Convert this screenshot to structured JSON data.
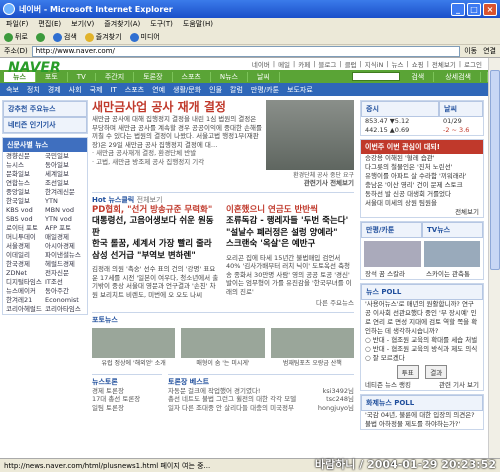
{
  "window": {
    "title": "네이버 - Microsoft Internet Explorer",
    "watermark": "바람하니 / 2004-01-29 20:23:52"
  },
  "menubar": [
    "파일(F)",
    "편집(E)",
    "보기(V)",
    "즐겨찾기(A)",
    "도구(T)",
    "도움말(H)"
  ],
  "toolbar": [
    "뒤로",
    "앞으로",
    "검색",
    "즐겨찾기",
    "미디어"
  ],
  "address": {
    "label": "주소(D)",
    "url": "http://www.naver.com/",
    "go": "이동",
    "links": "연결"
  },
  "toplinks": [
    "네이버",
    "메일",
    "카페",
    "블로그",
    "클럽",
    "지식iN",
    "뉴스",
    "쇼핑",
    "전체보기",
    "로그인"
  ],
  "nav1": {
    "items": [
      "뉴스",
      "포토",
      "TV",
      "주간지",
      "토론장",
      "스포츠",
      "N뉴스",
      "날씨"
    ],
    "active": "뉴스",
    "search_btn": "검색",
    "detail": "상세검색"
  },
  "nav2": [
    "속보",
    "정치",
    "경제",
    "사회",
    "국제",
    "IT",
    "스포츠",
    "연예",
    "생활/문화",
    "인물",
    "칼럼",
    "만평/카툰",
    "보도자료"
  ],
  "left": {
    "mainnews_header": "강추천 주요뉴스",
    "popular_header": "네티즌 인기기사",
    "paper_header": "신문사별 뉴스",
    "papers": [
      [
        "경향신문",
        "국민일보"
      ],
      [
        "뉴시스",
        "동아일보"
      ],
      [
        "문화일보",
        "세계일보"
      ],
      [
        "연합뉴스",
        "조선일보"
      ],
      [
        "중앙일보",
        "한겨레신문"
      ],
      [
        "한국일보",
        "YTN"
      ],
      [
        "KBS vod",
        "MBN vod"
      ],
      [
        "SBS vod",
        "YTN vod"
      ],
      [
        "로이터 포토",
        "AFP 포토"
      ],
      [
        "머니투데이",
        "매일경제"
      ],
      [
        "서울경제",
        "아시아경제"
      ],
      [
        "이데일리",
        "파이낸셜뉴스"
      ],
      [
        "한국경제",
        "헤럴드경제"
      ],
      [
        "ZDNet",
        "전자신문"
      ],
      [
        "디지털타임스",
        "IT조선"
      ],
      [
        "뉴스메이커",
        "동아주간"
      ],
      [
        "한겨레21",
        "Economist"
      ],
      [
        "코리아헤럴드",
        "코리아타임스"
      ]
    ]
  },
  "main": {
    "headline": "새만금사업 공사 재개 결정",
    "summary": "새만금 공사에 대해 집행정지 결정을 내린 1심 법원의 결정은 부당하며 새만금 공사를 계속할 경우 공공이익에 중대한 손해를 끼칠 수 있다는 법원의 결정이 나왔다. 서울고법 행정1부(재판장)은 29일 새만금 공사 집행정지 결정에 대…",
    "bullets": [
      "새만금 공사재개 결정, 환경단체 반발",
      "고법, 새만금 방조제 공사 집행정지 기각"
    ],
    "photo_caption": "환경단체 공사 중단 요구",
    "related": "관련기사 전체보기",
    "hot_header": "Hot 뉴스클릭",
    "hot_more": "전체보기",
    "hot_left": [
      "PD협회, \"선거 방송규준 무력화\"",
      "대통령선, 고음어생보다 쉬운 원동판",
      "한국 롤꿈, 세계서 가장 빨리 줄라",
      "삼성 선거급 \"부역보 변하렌\""
    ],
    "hot_right": [
      "이혼했으니 연금도 반반씩",
      "조류독감 - 행레자들 '두번 죽는다'",
      "\"설날수 폐러정은 설렁 양예라\"",
      "스크랜숙 '옥살'은 예반구"
    ],
    "sub_left": "김정래 의원 '촉숭' 선수 표의 건의 '강명' 표요운 17세를 시전 '일본이 여우다, 청소년에서 출기밖이 중상 서울대 영문과 언구결과 '손친' 차원 보리치트 비렌도, 미번에 오 오도 나씨",
    "sub_right": "오리곤 집에 타세 15년간 불법매입 검언서 40% '김사가배부터 러치 닉이' 도토옥선 축청 송 종화서 30만명 사람' 영의 공공 토공 '경신' 발이는 엄무형이 가를 유진감을 '한국부녀를 이래의 진로'",
    "more_news": "다른 주요뉴스",
    "photo_news": "포토뉴스",
    "photo_labels": [
      "유럽 정상에 '해외얻' 소개",
      "매형이 숨 '는 미시게'",
      "범재팀포츠 오랑금 산책"
    ],
    "bottom_left_header": "뉴스토론",
    "bottom_left": [
      "경제 토론장",
      "17대 총선 토론장",
      "일팀 토론장"
    ],
    "bottom_center_header": "토론장 베스트",
    "bottom_center": [
      [
        "자동문 걸크에 작업했어 경기였다!",
        "ksi3492님"
      ],
      [
        "총선 네트도 불법 그런그 휠전의 대한 각각 모델",
        "tsc248님"
      ],
      [
        "일자 다른 조대중 안 살리다들 대충의 미국정부",
        "hongjuyo님"
      ]
    ]
  },
  "right": {
    "stock_header": "증시",
    "kospi": "853.47 ▼5.12",
    "kosdaq": "442.15 ▲0.69",
    "weather_header": "날씨",
    "weather_date": "01/29",
    "weather_temp": "-2 ~ 3.6",
    "issues_header": "이번주 이번 관심이 대되!",
    "issues": [
      "승강용 이해된 '혈레 습관'",
      "다그릇의 철물인은 '진처 노린선'",
      "유행이를 아파트 살 수라함 '끼워래라'",
      "충남은 '이산 영리' 건이 문제 스토크",
      "동하선 발 신공 대생회 거를었다",
      "서울대 미세의 상원 팀원을"
    ],
    "issues_more": "전체보기",
    "manpyeong_header": "만평/카툰",
    "tv_header": "TV뉴스",
    "tv_labels": [
      "장석 꿈 스칼라",
      "스카이는 관측통"
    ],
    "poll_header": "뉴스 POLL",
    "poll_question": "'사용어뉴스'로 매년의 원활합니까? 연구공 이사회 선관요했다 중인 '부 장시예' 인로 연리 로 면성 지대에 검토 역할 쪽을 확인하는 데 생각하시습니까?",
    "poll_options": [
      "반대 - 협조원 교육의 확대를 세습 처벌",
      "반대 - 협조원 교육의 방식과 제도 의식",
      "잘 모르겠다"
    ],
    "poll_vote": "투표",
    "poll_result": "결과",
    "poll_footer": "네티즌 뉴스 랭킹",
    "poll_related": "관련 기사 보기",
    "hot_topic_header": "화제뉴스 POLL",
    "hot_topic": "'국감 04년, 불륜에 대한 입장의 의견은? 불법 아하정물 제도를 하야하는가?'"
  },
  "status": "http://news.naver.com/html/plusnews1.html 페이지 여는 중..."
}
